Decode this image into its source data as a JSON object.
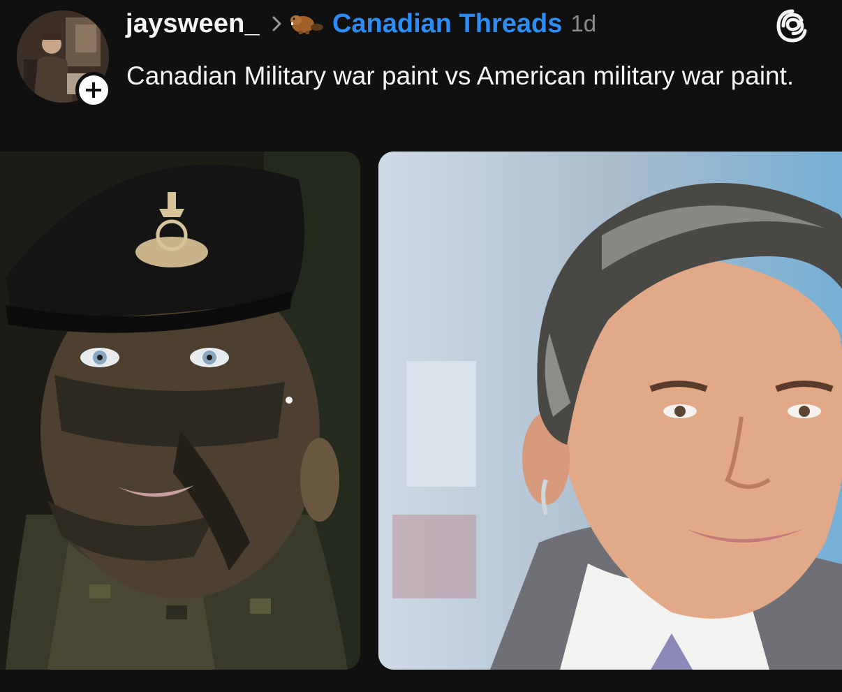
{
  "post": {
    "username": "jaysween_",
    "community": "Canadian Threads",
    "community_icon": "beaver-icon",
    "timestamp": "1d",
    "text": "Canadian Military war paint vs American military war paint.",
    "follow_icon": "plus-icon",
    "app_icon": "threads-logo-icon"
  },
  "colors": {
    "background": "#101010",
    "text": "#f3f5f7",
    "community_link": "#2c8df7",
    "muted": "#8c8c8c"
  },
  "images": [
    {
      "id": "left",
      "subject": "soldier with camouflage face paint and black beret"
    },
    {
      "id": "right",
      "subject": "man in suit with styled grey hair"
    }
  ]
}
